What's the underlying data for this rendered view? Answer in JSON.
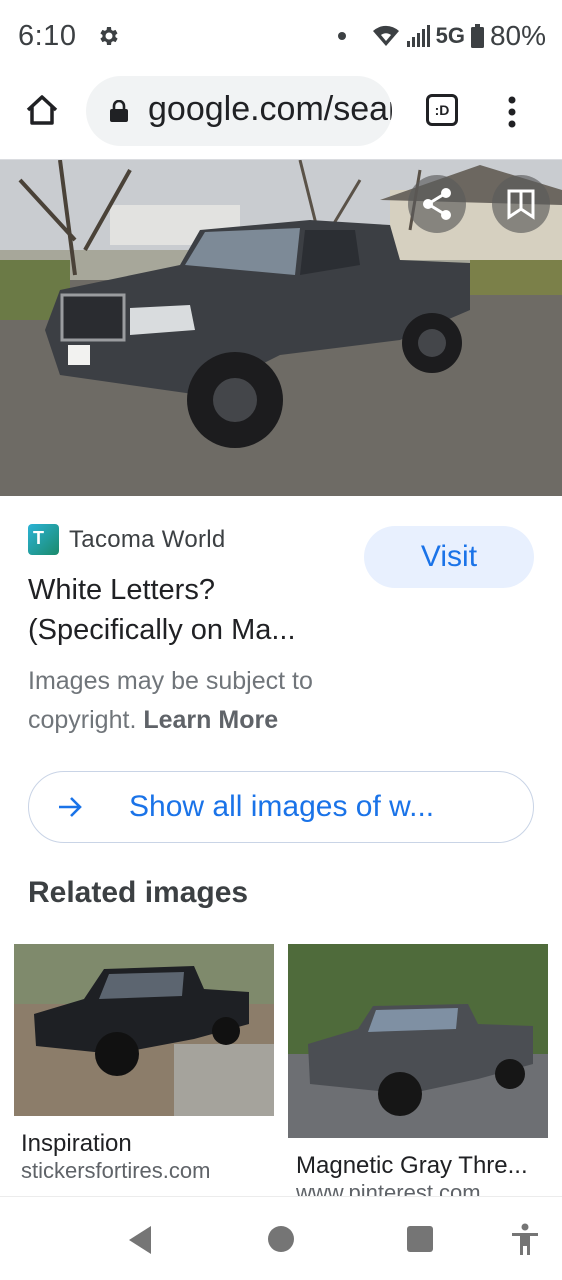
{
  "status_bar": {
    "time": "6:10",
    "network": "5G",
    "battery": "80%"
  },
  "browser": {
    "url": "google.com/search",
    "tab_switcher_label": ":D"
  },
  "result": {
    "source_name": "Tacoma World",
    "favicon_letter": "T",
    "visit_label": "Visit",
    "title": "White Letters? (Specifically on Ma...",
    "copyright_text": "Images may be subject to copyright.",
    "learn_more_label": "Learn More",
    "show_all_label": "Show all images of w..."
  },
  "related": {
    "heading": "Related images",
    "items": [
      {
        "title": "Inspiration",
        "site": "stickersfortires.com"
      },
      {
        "title": "Magnetic Gray Thre...",
        "site": "www.pinterest.com"
      }
    ]
  },
  "colors": {
    "accent": "#1a73e8",
    "visit_bg": "#e8f0fe",
    "pill_bg": "#f1f3f4"
  },
  "icons": [
    "settings-icon",
    "wifi-icon",
    "signal-icon",
    "battery-icon",
    "home-icon",
    "lock-icon",
    "tab-switcher-icon",
    "menu-icon",
    "share-icon",
    "bookmark-icon",
    "arrow-right-icon",
    "back-icon",
    "home-circle-icon",
    "recents-icon",
    "accessibility-icon"
  ]
}
